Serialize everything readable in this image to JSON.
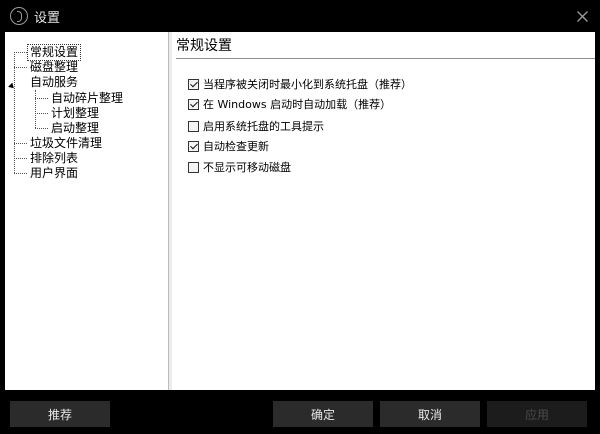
{
  "window": {
    "title": "设置",
    "app_icon": "app-logo-icon",
    "close_icon": "close-icon"
  },
  "tree": {
    "items": [
      {
        "label": "常规设置",
        "level": 0,
        "selected": true
      },
      {
        "label": "磁盘整理",
        "level": 0
      },
      {
        "label": "自动服务",
        "level": 0,
        "expanded": true
      },
      {
        "label": "自动碎片整理",
        "level": 1
      },
      {
        "label": "计划整理",
        "level": 1
      },
      {
        "label": "启动整理",
        "level": 1
      },
      {
        "label": "垃圾文件清理",
        "level": 0
      },
      {
        "label": "排除列表",
        "level": 0
      },
      {
        "label": "用户界面",
        "level": 0
      }
    ]
  },
  "content": {
    "title": "常规设置",
    "options": [
      {
        "label": "当程序被关闭时最小化到系统托盘（推荐）",
        "checked": true
      },
      {
        "label": "在 Windows 启动时自动加载（推荐）",
        "checked": true
      },
      {
        "label": "启用系统托盘的工具提示",
        "checked": false
      },
      {
        "label": "自动检查更新",
        "checked": true
      },
      {
        "label": "不显示可移动磁盘",
        "checked": false
      }
    ]
  },
  "buttons": {
    "recommend": "推荐",
    "ok": "确定",
    "cancel": "取消",
    "apply": "应用"
  }
}
